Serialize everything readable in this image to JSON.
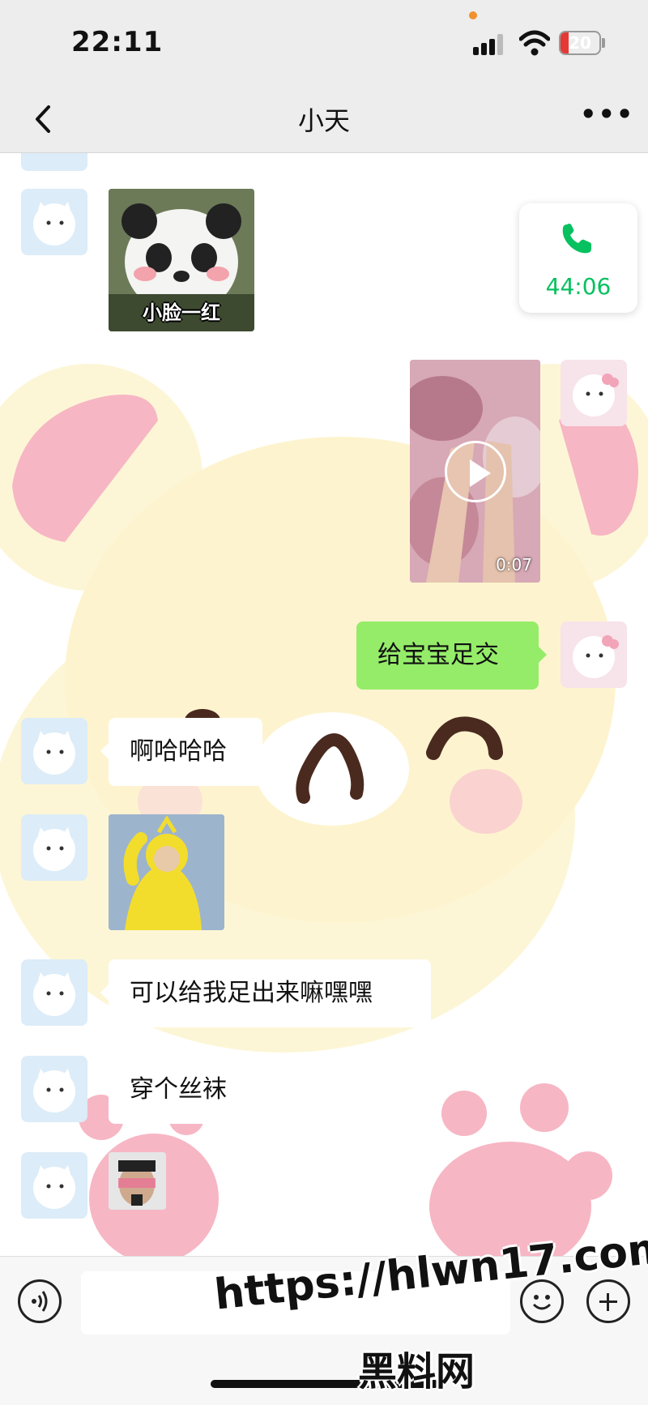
{
  "status_bar": {
    "time": "22:11",
    "battery": "20"
  },
  "header": {
    "title": "小天"
  },
  "call": {
    "duration": "44:06"
  },
  "messages": {
    "panda_caption": "小脸一红",
    "video_duration": "0:07",
    "sent_text": "给宝宝足交",
    "recv_1": "啊哈哈哈",
    "recv_2": "可以给我足出来嘛嘿嘿",
    "recv_3": "穿个丝袜"
  },
  "watermark": {
    "url": "https://hlwn17.com",
    "name": "黑料网"
  },
  "colors": {
    "accent_green": "#07c160",
    "bubble_green": "#95ec69",
    "header_bg": "#ededed"
  }
}
